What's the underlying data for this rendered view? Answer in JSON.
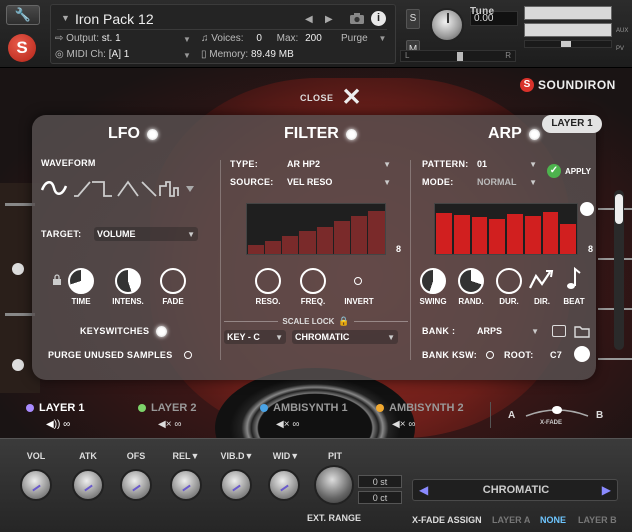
{
  "kontakt": {
    "instrument_name": "Iron Pack 12",
    "output_label": "Output:",
    "output_value": "st. 1",
    "midi_label": "MIDI Ch:",
    "midi_value": "[A]  1",
    "voices_label": "Voices:",
    "voices_value": "0",
    "max_label": "Max:",
    "max_value": "200",
    "memory_label": "Memory:",
    "memory_value": "89.49 MB",
    "purge_label": "Purge",
    "solo_label": "S",
    "mute_label": "M",
    "tune_label": "Tune",
    "tune_value": "0.00",
    "aux_label": "AUX",
    "pv_label": "PV",
    "meter_l": "L",
    "meter_r": "R"
  },
  "header": {
    "close_label": "CLOSE",
    "brand": "SOUNDIRON",
    "layer_badge": "LAYER 1"
  },
  "lfo": {
    "title": "LFO",
    "waveform_label": "WAVEFORM",
    "target_label": "TARGET:",
    "target_value": "VOLUME",
    "knobs": [
      "TIME",
      "INTENS.",
      "FADE"
    ],
    "keyswitches_label": "KEYSWITCHES",
    "purge_unused_label": "PURGE UNUSED SAMPLES"
  },
  "filter": {
    "title": "FILTER",
    "type_label": "TYPE:",
    "type_value": "AR HP2",
    "source_label": "SOURCE:",
    "source_value": "VEL RESO",
    "steps": "8",
    "bars": [
      0.18,
      0.26,
      0.36,
      0.46,
      0.55,
      0.66,
      0.76,
      0.86
    ],
    "knobs": [
      "RESO.",
      "FREQ.",
      "INVERT"
    ],
    "scale_lock_label": "SCALE LOCK",
    "key_value": "KEY - C",
    "scale_value": "CHROMATIC"
  },
  "arp": {
    "title": "ARP",
    "pattern_label": "PATTERN:",
    "pattern_value": "01",
    "mode_label": "MODE:",
    "mode_value": "NORMAL",
    "apply_label": "APPLY",
    "steps": "8",
    "bars": [
      0.82,
      0.78,
      0.74,
      0.7,
      0.8,
      0.76,
      0.84,
      0.6
    ],
    "knobs": [
      "SWING",
      "RAND.",
      "DUR.",
      "DIR.",
      "BEAT"
    ],
    "bank_label": "BANK :",
    "bank_value": "ARPS",
    "bank_ksw_label": "BANK KSW:",
    "root_label": "ROOT:",
    "root_value": "C7"
  },
  "layers": [
    {
      "name": "LAYER 1",
      "color": "#a98bff",
      "active": true
    },
    {
      "name": "LAYER 2",
      "color": "#7dd36a",
      "active": false
    },
    {
      "name": "AMBISYNTH 1",
      "color": "#4aa3e6",
      "active": false
    },
    {
      "name": "AMBISYNTH 2",
      "color": "#f0a830",
      "active": false
    }
  ],
  "xfade": {
    "a": "A",
    "b": "B",
    "label": "X-FADE"
  },
  "bottom": {
    "knobs": [
      "VOL",
      "ATK",
      "OFS",
      "REL▼",
      "VIB.D▼",
      "WID▼"
    ],
    "pit_label": "PIT",
    "ext_range_label": "EXT. RANGE",
    "pit_st": "0 st",
    "pit_ct": "0 ct",
    "scale_value": "CHROMATIC",
    "xfade_assign_label": "X-FADE ASSIGN",
    "xfade_options": [
      "LAYER A",
      "NONE",
      "LAYER B"
    ],
    "xfade_selected": "NONE"
  },
  "colors": {
    "accent": "#a98bff",
    "arp_bar": "#d11f1f",
    "filter_bar": "#7a2a2a",
    "apply": "#4db34d"
  }
}
